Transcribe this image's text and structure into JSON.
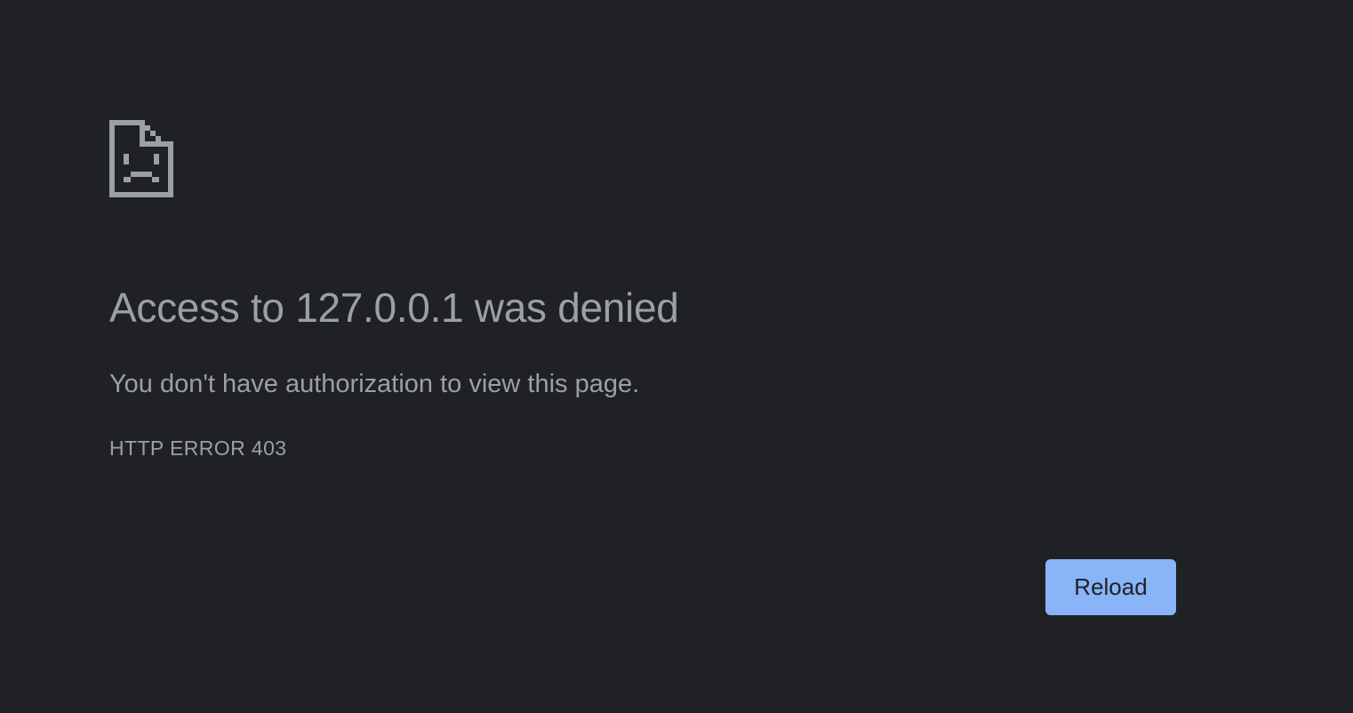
{
  "icon": "sad-page-icon",
  "heading": "Access to 127.0.0.1 was denied",
  "message": "You don't have authorization to view this page.",
  "error_code": "HTTP ERROR 403",
  "reload_label": "Reload",
  "colors": {
    "background": "#202124",
    "text": "#9aa0a6",
    "icon": "#9aa0a6",
    "button_bg": "#8ab4f8",
    "button_text": "#202124"
  }
}
